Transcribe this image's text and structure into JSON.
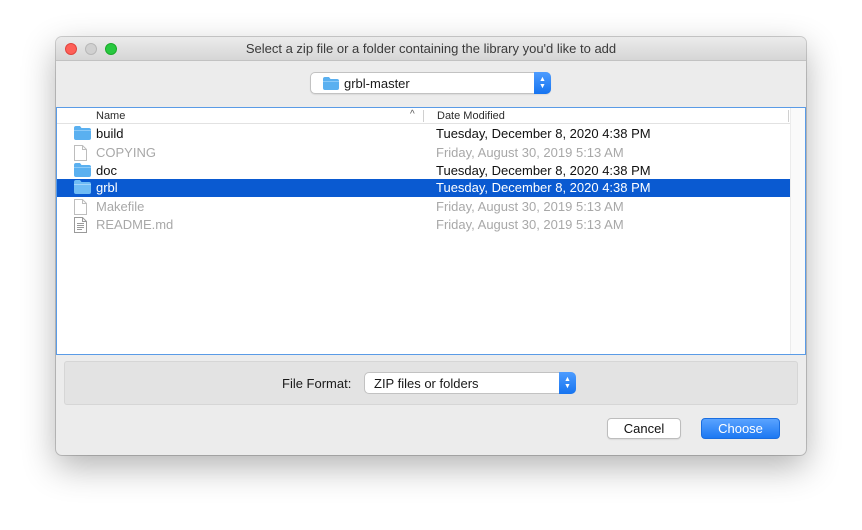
{
  "window": {
    "title": "Select a zip file or a folder containing the library you'd like to add"
  },
  "path_popup": {
    "current_folder": "grbl-master"
  },
  "file_list": {
    "headers": {
      "name": "Name",
      "date_modified": "Date Modified"
    },
    "sort_indicator": "^",
    "rows": [
      {
        "name": "build",
        "date": "Tuesday, December 8, 2020 4:38 PM",
        "kind": "folder",
        "enabled": true,
        "selected": false
      },
      {
        "name": "COPYING",
        "date": "Friday, August 30, 2019 5:13 AM",
        "kind": "file",
        "enabled": false,
        "selected": false
      },
      {
        "name": "doc",
        "date": "Tuesday, December 8, 2020 4:38 PM",
        "kind": "folder",
        "enabled": true,
        "selected": false
      },
      {
        "name": "grbl",
        "date": "Tuesday, December 8, 2020 4:38 PM",
        "kind": "folder",
        "enabled": true,
        "selected": true
      },
      {
        "name": "Makefile",
        "date": "Friday, August 30, 2019 5:13 AM",
        "kind": "file",
        "enabled": false,
        "selected": false
      },
      {
        "name": "README.md",
        "date": "Friday, August 30, 2019 5:13 AM",
        "kind": "text-file",
        "enabled": false,
        "selected": false
      }
    ]
  },
  "file_format": {
    "label": "File Format:",
    "selected": "ZIP files or folders"
  },
  "buttons": {
    "cancel": "Cancel",
    "choose": "Choose"
  },
  "colors": {
    "selection": "#0a5ad1",
    "accent": "#1c78f2",
    "folder": "#5ab0f0",
    "close": "#fe5f57",
    "maximize": "#28c840"
  }
}
